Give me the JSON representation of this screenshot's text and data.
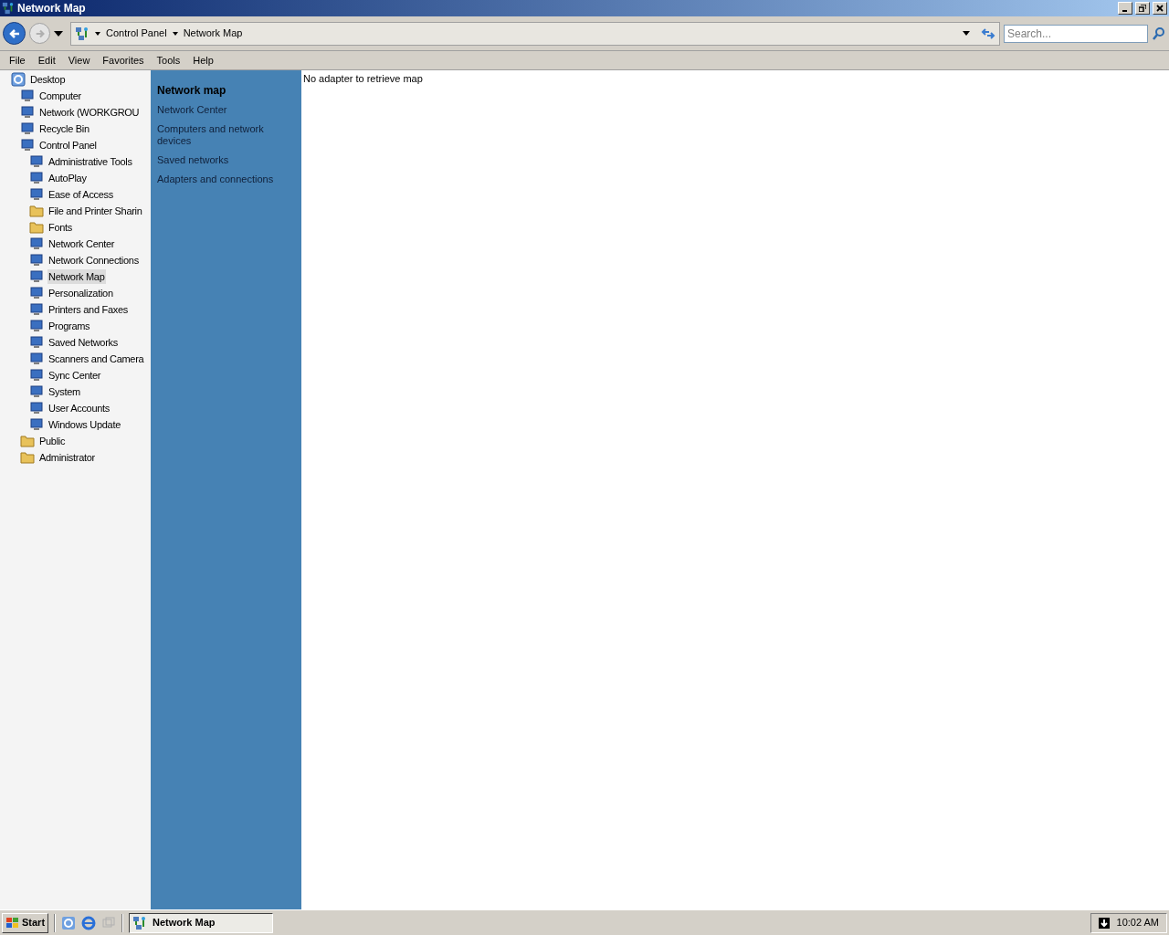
{
  "window": {
    "title": "Network Map"
  },
  "address": {
    "breadcrumb": [
      "Control Panel",
      "Network Map"
    ]
  },
  "search": {
    "placeholder": "Search..."
  },
  "menu": [
    "File",
    "Edit",
    "View",
    "Favorites",
    "Tools",
    "Help"
  ],
  "tree": [
    {
      "label": "Desktop",
      "kind": "desktop",
      "selected": false,
      "children": [
        {
          "label": "Computer",
          "kind": "item",
          "selected": false
        },
        {
          "label": "Network (WORKGROU",
          "kind": "item",
          "selected": false
        },
        {
          "label": "Recycle Bin",
          "kind": "item",
          "selected": false
        },
        {
          "label": "Control Panel",
          "kind": "item",
          "selected": false,
          "children": [
            {
              "label": "Administrative Tools",
              "kind": "item",
              "selected": false
            },
            {
              "label": "AutoPlay",
              "kind": "item",
              "selected": false
            },
            {
              "label": "Ease of Access",
              "kind": "item",
              "selected": false
            },
            {
              "label": "File and Printer Sharin",
              "kind": "folder",
              "selected": false
            },
            {
              "label": "Fonts",
              "kind": "folder",
              "selected": false
            },
            {
              "label": "Network Center",
              "kind": "item",
              "selected": false
            },
            {
              "label": "Network Connections",
              "kind": "item",
              "selected": false
            },
            {
              "label": "Network Map",
              "kind": "item",
              "selected": true
            },
            {
              "label": "Personalization",
              "kind": "item",
              "selected": false
            },
            {
              "label": "Printers and Faxes",
              "kind": "item",
              "selected": false
            },
            {
              "label": "Programs",
              "kind": "item",
              "selected": false
            },
            {
              "label": "Saved Networks",
              "kind": "item",
              "selected": false
            },
            {
              "label": "Scanners and Camera",
              "kind": "item",
              "selected": false
            },
            {
              "label": "Sync Center",
              "kind": "item",
              "selected": false
            },
            {
              "label": "System",
              "kind": "item",
              "selected": false
            },
            {
              "label": "User Accounts",
              "kind": "item",
              "selected": false
            },
            {
              "label": "Windows Update",
              "kind": "item",
              "selected": false
            }
          ]
        },
        {
          "label": "Public",
          "kind": "folder",
          "selected": false
        },
        {
          "label": "Administrator",
          "kind": "folder",
          "selected": false
        }
      ]
    }
  ],
  "task_pane": {
    "links": [
      {
        "label": "Network map",
        "selected": true
      },
      {
        "label": "Network Center",
        "selected": false
      },
      {
        "label": "Computers and network devices",
        "selected": false
      },
      {
        "label": "Saved networks",
        "selected": false
      },
      {
        "label": "Adapters and connections",
        "selected": false
      }
    ]
  },
  "content": {
    "message": "No adapter to retrieve map"
  },
  "taskbar": {
    "start": "Start",
    "tasks": [
      {
        "label": "Network Map",
        "selected": true
      }
    ],
    "clock": "10:02 AM"
  }
}
